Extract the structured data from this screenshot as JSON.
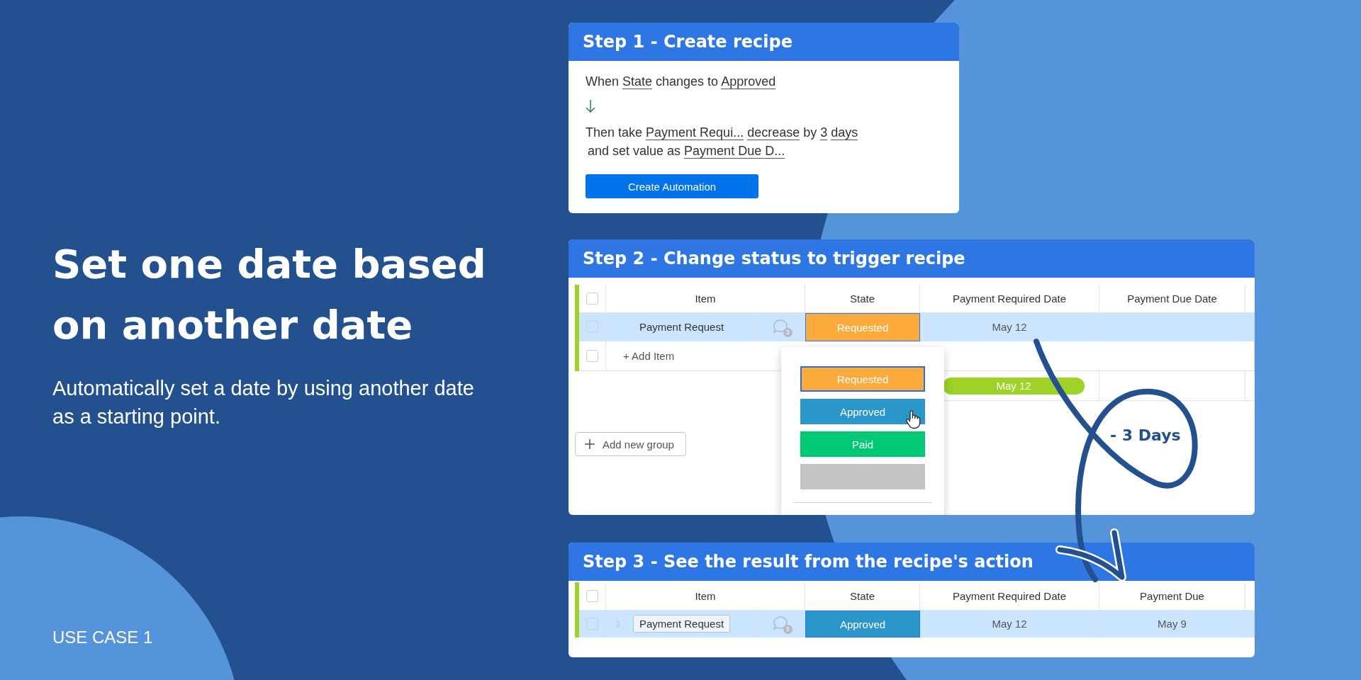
{
  "headline": "Set one date based on another date",
  "description": "Automatically set a date by using another date as a starting point.",
  "use_case_label": "USE CASE 1",
  "step1": {
    "title": "Step 1 - Create recipe",
    "lines": [
      [
        {
          "kind": "text",
          "text": "When "
        },
        {
          "kind": "field",
          "text": "State"
        },
        {
          "kind": "text",
          "text": " changes to "
        },
        {
          "kind": "field",
          "text": "Approved"
        }
      ],
      [
        {
          "kind": "text",
          "text": "Then take "
        },
        {
          "kind": "field",
          "text": "Payment Requi..."
        },
        {
          "kind": "field",
          "text": "decrease"
        },
        {
          "kind": "text",
          "text": " by "
        },
        {
          "kind": "field",
          "text": "3"
        },
        {
          "kind": "field",
          "text": "days"
        }
      ],
      [
        {
          "kind": "text",
          "text": "and set value as "
        },
        {
          "kind": "field",
          "text": "Payment Due D..."
        }
      ]
    ],
    "button": "Create Automation"
  },
  "step2": {
    "title": "Step 2 - Change status to trigger recipe",
    "table": {
      "columns": [
        "Item",
        "State",
        "Payment Required Date",
        "Payment Due Date"
      ],
      "header_checked": false,
      "rows": [
        {
          "item": "Payment Request",
          "item_editing": false,
          "checked": false,
          "comment_count": "3",
          "state": {
            "label": "Requested",
            "color": "#fdab3d"
          },
          "payment_required": "May 12",
          "selected": true
        }
      ],
      "add_item": "+ Add Item",
      "add_item_checked": false,
      "summary_date": "May 12"
    },
    "add_group": "Add new group",
    "status_menu": {
      "options": [
        {
          "label": "Requested",
          "color": "#fdab3d",
          "selected": true
        },
        {
          "label": "Approved",
          "color": "#2a96c9",
          "selected": false
        },
        {
          "label": "Paid",
          "color": "#00c875",
          "selected": false
        },
        {
          "color": "#c4c4c4",
          "selected": false
        }
      ]
    }
  },
  "step3": {
    "title": "Step 3 - See the result from the recipe's action",
    "table": {
      "columns": [
        "Item",
        "State",
        "Payment Required Date",
        "Payment Due"
      ],
      "header_checked": false,
      "rows": [
        {
          "item": "Payment Request",
          "item_editing": true,
          "checked": false,
          "comment_count": "3",
          "state": {
            "label": "Approved",
            "color": "#2a96c9"
          },
          "payment_required": "May 12",
          "payment_due": "May 9",
          "selected": true
        }
      ]
    }
  },
  "annotation": "- 3 Days"
}
